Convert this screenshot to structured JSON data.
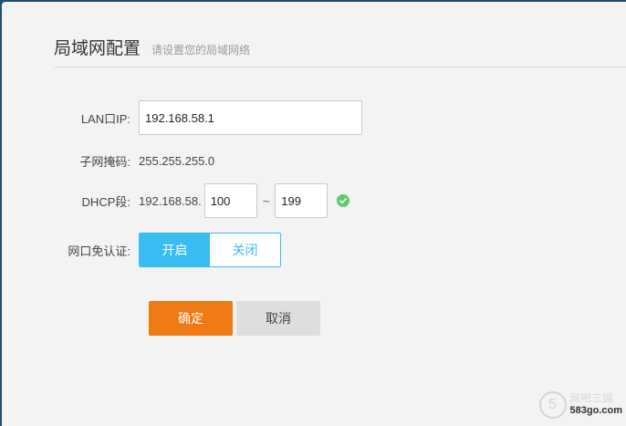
{
  "header": {
    "title": "局域网配置",
    "subtitle": "请设置您的局域网络"
  },
  "form": {
    "lan_ip": {
      "label": "LAN口IP:",
      "value": "192.168.58.1"
    },
    "subnet": {
      "label": "子网掩码:",
      "value": "255.255.255.0"
    },
    "dhcp": {
      "label": "DHCP段:",
      "prefix": "192.168.58.",
      "start": "100",
      "separator": "~",
      "end": "199",
      "valid": true
    },
    "port_auth": {
      "label": "网口免认证:",
      "on_label": "开启",
      "off_label": "关闭",
      "selected": "开启"
    }
  },
  "buttons": {
    "confirm": "确定",
    "cancel": "取消"
  },
  "watermark": {
    "logo": "5",
    "top": "网吧三国",
    "bottom": "583go.com"
  },
  "colors": {
    "accent": "#38bdf0",
    "confirm": "#ef7a13",
    "valid": "#5ccc6e",
    "frame": "#1f4e73"
  },
  "icons": {
    "dhcp_status": "check-circle-icon"
  }
}
